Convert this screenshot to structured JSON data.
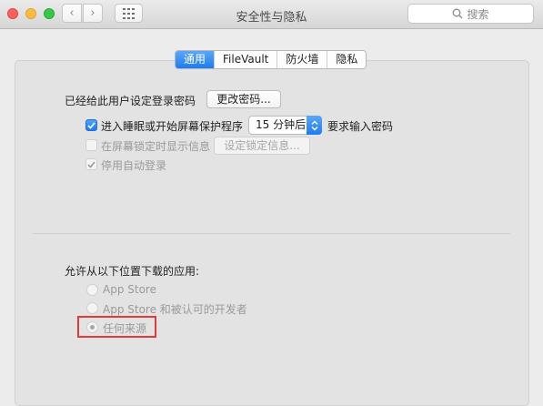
{
  "window": {
    "title": "安全性与隐私"
  },
  "toolbar": {
    "back_icon": "‹",
    "forward_icon": "›",
    "search_placeholder": "搜索"
  },
  "tabs": [
    {
      "label": "通用",
      "active": true
    },
    {
      "label": "FileVault",
      "active": false
    },
    {
      "label": "防火墙",
      "active": false
    },
    {
      "label": "隐私",
      "active": false
    }
  ],
  "general": {
    "password_label": "已经给此用户设定登录密码",
    "change_password_button": "更改密码...",
    "require_password": {
      "label": "进入睡眠或开始屏幕保护程序",
      "checked": true,
      "delay_value": "15 分钟后",
      "suffix": "要求输入密码"
    },
    "show_message": {
      "label": "在屏幕锁定时显示信息",
      "checked": false,
      "button": "设定锁定信息..."
    },
    "disable_auto_login": {
      "label": "停用自动登录",
      "checked": true
    }
  },
  "downloads": {
    "label": "允许从以下位置下载的应用:",
    "options": [
      {
        "label": "App Store",
        "selected": false
      },
      {
        "label": "App Store 和被认可的开发者",
        "selected": false
      },
      {
        "label": "任何来源",
        "selected": true
      }
    ]
  },
  "colors": {
    "accent": "#1e7cf0",
    "highlight": "#e03a3a"
  }
}
